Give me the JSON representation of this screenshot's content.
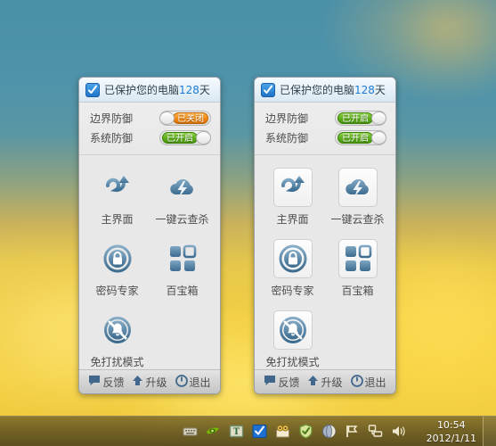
{
  "desktop": {
    "wallpaper_top_color": "#4a8fa8",
    "wallpaper_bottom_color": "#f2cf44"
  },
  "panels": [
    {
      "id": "panel-left",
      "header": {
        "icon": "blue-shield-check-icon",
        "prefix": "已保护您的电脑",
        "days": "128",
        "suffix": "天"
      },
      "status_rows": [
        {
          "label": "边界防御",
          "state": "off",
          "state_text": "已关闭"
        },
        {
          "label": "系统防御",
          "state": "on",
          "state_text": "已开启"
        }
      ],
      "framed_icons": false,
      "tiles": [
        {
          "icon": "swirl-arrow-icon",
          "label": "主界面"
        },
        {
          "icon": "cloud-lightning-icon",
          "label": "一键云查杀"
        },
        {
          "icon": "lock-circle-icon",
          "label": "密码专家"
        },
        {
          "icon": "four-squares-icon",
          "label": "百宝箱"
        },
        {
          "icon": "no-disturb-bell-icon",
          "label": "免打扰模式"
        }
      ],
      "footer": [
        {
          "icon": "speech-bubble-icon",
          "label": "反馈"
        },
        {
          "icon": "up-arrow-icon",
          "label": "升级"
        },
        {
          "icon": "power-icon",
          "label": "退出"
        }
      ]
    },
    {
      "id": "panel-right",
      "header": {
        "icon": "blue-shield-check-icon",
        "prefix": "已保护您的电脑",
        "days": "128",
        "suffix": "天"
      },
      "status_rows": [
        {
          "label": "边界防御",
          "state": "on",
          "state_text": "已开启"
        },
        {
          "label": "系统防御",
          "state": "on",
          "state_text": "已开启"
        }
      ],
      "framed_icons": true,
      "tiles": [
        {
          "icon": "swirl-arrow-icon",
          "label": "主界面"
        },
        {
          "icon": "cloud-lightning-icon",
          "label": "一键云查杀"
        },
        {
          "icon": "lock-circle-icon",
          "label": "密码专家"
        },
        {
          "icon": "four-squares-icon",
          "label": "百宝箱"
        },
        {
          "icon": "no-disturb-bell-icon",
          "label": "免打扰模式"
        }
      ],
      "footer": [
        {
          "icon": "speech-bubble-icon",
          "label": "反馈"
        },
        {
          "icon": "up-arrow-icon",
          "label": "升级"
        },
        {
          "icon": "power-icon",
          "label": "退出"
        }
      ]
    }
  ],
  "taskbar": {
    "tray_icons": [
      "keyboard-ime-icon",
      "nvidia-eye-icon",
      "text-tool-t-icon",
      "antivirus-check-icon",
      "mail-frog-icon",
      "security-shield-icon",
      "browser-sphere-icon",
      "flag-icon",
      "network-icon",
      "speaker-volume-icon"
    ],
    "clock": {
      "time": "10:54",
      "date": "2012/1/11"
    },
    "show_desktop": "show-desktop-button"
  },
  "colors": {
    "toggle_on": "#5fae1e",
    "toggle_off": "#f08a16",
    "days_text": "#1e7ad0",
    "icon_blue": "#4a7fa5"
  }
}
